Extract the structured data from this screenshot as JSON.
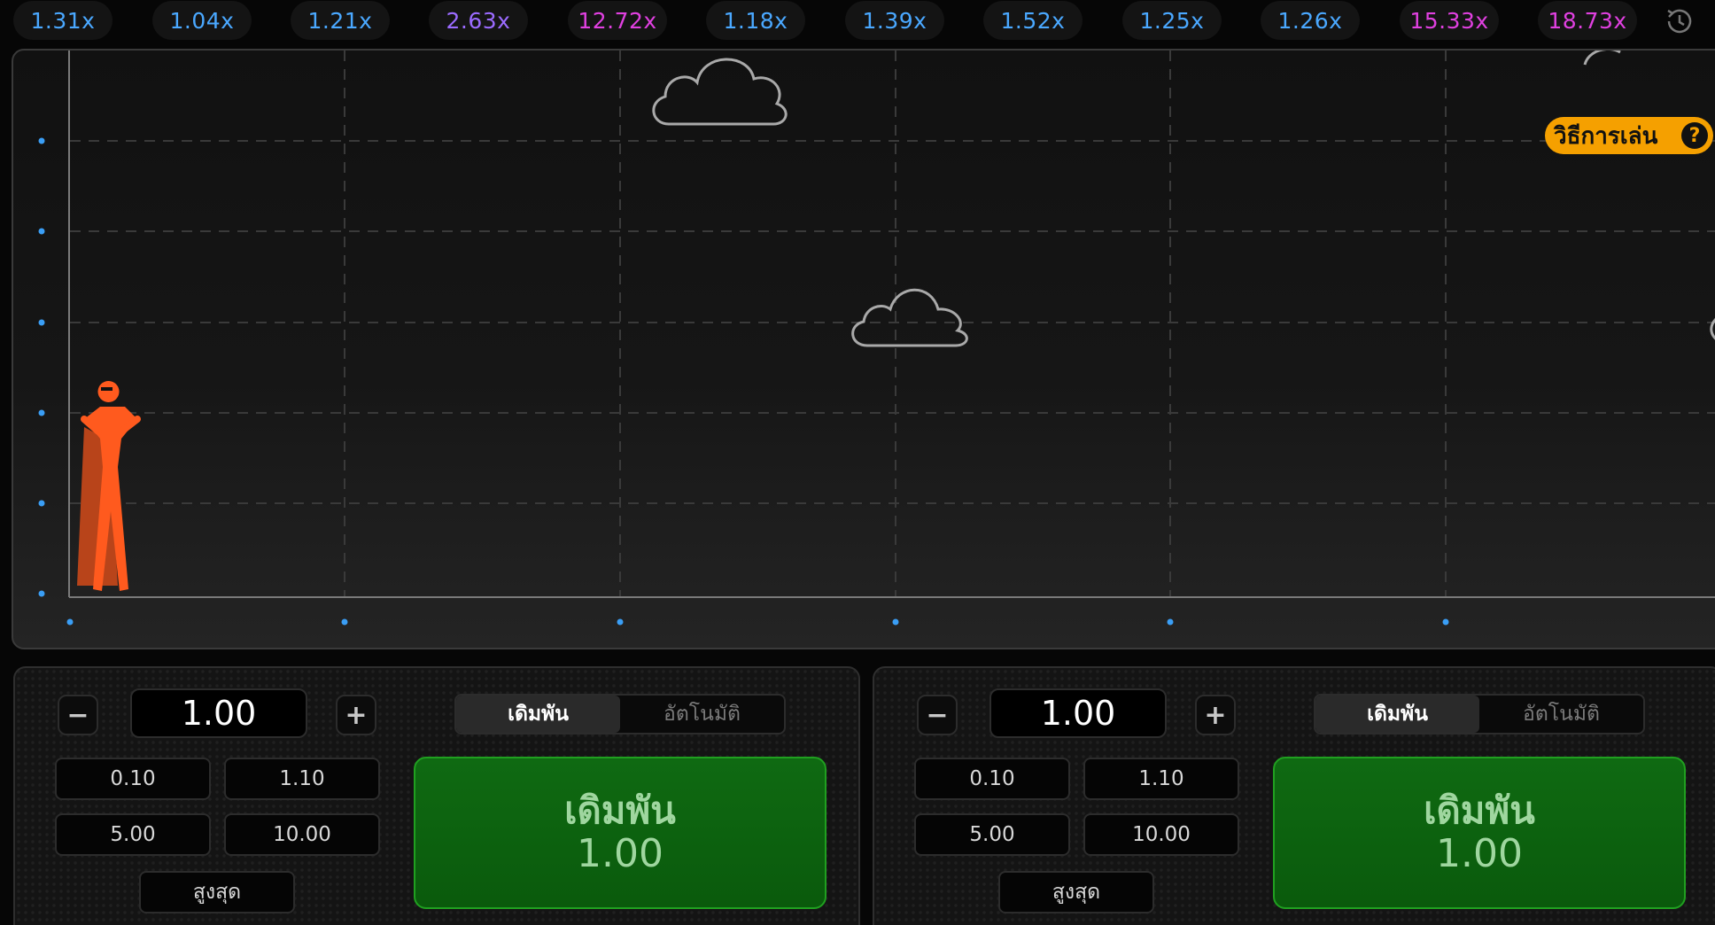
{
  "history": [
    {
      "value": "1.31x",
      "color": "#4aa8ff"
    },
    {
      "value": "1.04x",
      "color": "#4aa8ff"
    },
    {
      "value": "1.21x",
      "color": "#4aa8ff"
    },
    {
      "value": "2.63x",
      "color": "#9b6bff"
    },
    {
      "value": "12.72x",
      "color": "#e040e0"
    },
    {
      "value": "1.18x",
      "color": "#4aa8ff"
    },
    {
      "value": "1.39x",
      "color": "#4aa8ff"
    },
    {
      "value": "1.52x",
      "color": "#4aa8ff"
    },
    {
      "value": "1.25x",
      "color": "#4aa8ff"
    },
    {
      "value": "1.26x",
      "color": "#4aa8ff"
    },
    {
      "value": "15.33x",
      "color": "#e040e0"
    },
    {
      "value": "18.73x",
      "color": "#e040e0"
    }
  ],
  "history_icon": "clock-history-icon",
  "how_to_play": {
    "label": "วิธีการเล่น",
    "icon": "question-icon"
  },
  "character": {
    "icon": "superhero-icon",
    "color": "#ff5a1e"
  },
  "colors": {
    "accent": "#f5a000",
    "bet_green": "#0f6a12",
    "axis_dot": "#3a9ef5"
  },
  "panels": [
    {
      "amount": "1.00",
      "minus": "−",
      "plus": "+",
      "chips": [
        "0.10",
        "1.10",
        "5.00",
        "10.00"
      ],
      "max_label": "สูงสุด",
      "tabs": [
        "เดิมพัน",
        "อัตโนมัติ"
      ],
      "active_tab": 0,
      "bet_label": "เดิมพัน",
      "bet_amount": "1.00"
    },
    {
      "amount": "1.00",
      "minus": "−",
      "plus": "+",
      "chips": [
        "0.10",
        "1.10",
        "5.00",
        "10.00"
      ],
      "max_label": "สูงสุด",
      "tabs": [
        "เดิมพัน",
        "อัตโนมัติ"
      ],
      "active_tab": 0,
      "bet_label": "เดิมพัน",
      "bet_amount": "1.00"
    }
  ]
}
